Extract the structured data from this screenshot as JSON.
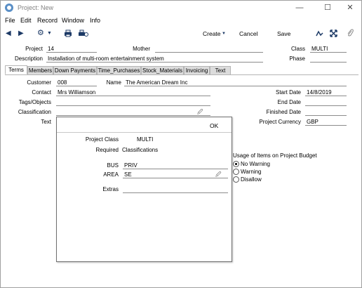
{
  "window": {
    "title": "Project: New",
    "min": "—",
    "max": "☐",
    "close": "✕"
  },
  "menu": [
    "File",
    "Edit",
    "Record",
    "Window",
    "Info"
  ],
  "toolbar": {
    "create_label": "Create",
    "cancel_label": "Cancel",
    "save_label": "Save"
  },
  "header": {
    "project_label": "Project",
    "project_value": "14",
    "mother_label": "Mother",
    "mother_value": "",
    "class_label": "Class",
    "class_value": "MULTI",
    "description_label": "Description",
    "description_value": "Installation of multi-room entertainment system",
    "phase_label": "Phase",
    "phase_value": ""
  },
  "tabs": [
    "Terms",
    "Members",
    "Down Payments",
    "Time_Purchases",
    "Stock_Materials",
    "Invoicing",
    "Text"
  ],
  "terms": {
    "customer_label": "Customer",
    "customer_value": "008",
    "name_label": "Name",
    "name_value": "The American Dream Inc",
    "contact_label": "Contact",
    "contact_value": "Mrs Williamson",
    "tags_label": "Tags/Objects",
    "classification_label": "Classification",
    "text_label": "Text",
    "start_date_label": "Start Date",
    "start_date_value": "14/8/2019",
    "end_date_label": "End Date",
    "finished_date_label": "Finished Date",
    "currency_label": "Project Currency",
    "currency_value": "GBP",
    "usage_title": "Usage of Items on Project Budget",
    "usage_options": [
      "No Warning",
      "Warning",
      "Disallow"
    ],
    "usage_selected": 0
  },
  "dialog": {
    "ok_label": "OK",
    "project_class_label": "Project Class",
    "project_class_value": "MULTI",
    "required_label": "Required",
    "required_value": "Classifications",
    "bus_label": "BUS",
    "bus_value": "PRIV",
    "area_label": "AREA",
    "area_value": "SE",
    "extras_label": "Extras",
    "extras_value": ""
  }
}
